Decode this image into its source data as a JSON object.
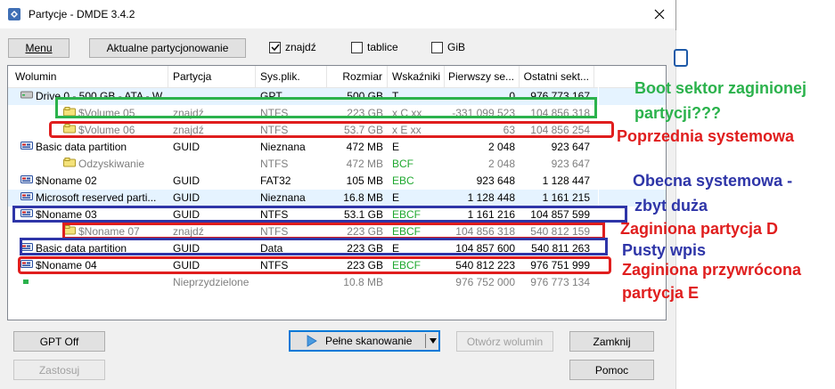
{
  "window": {
    "title": "Partycje - DMDE 3.4.2",
    "icons": {
      "app": "dmde-app-icon",
      "close": "close-icon"
    }
  },
  "toolbar": {
    "menu_label": "Menu",
    "current_partitioning_label": "Aktualne partycjonowanie",
    "checkboxes": [
      {
        "label": "znajdź",
        "checked": true
      },
      {
        "label": "tablice",
        "checked": false
      },
      {
        "label": "GiB",
        "checked": false
      }
    ]
  },
  "columns": [
    "Wolumin",
    "Partycja",
    "Sys.plik.",
    "Rozmiar",
    "Wskaźniki",
    "Pierwszy se...",
    "Ostatni sekt..."
  ],
  "rows": [
    {
      "indent": 0,
      "icon": "drive-icon",
      "name": "Drive 0 - 500 GB - ATA - W...",
      "partition": "",
      "fs": "GPT",
      "size": "500 GB",
      "flags": "T",
      "first": "0",
      "last": "976 773 167",
      "gray": false,
      "selected": true
    },
    {
      "indent": 1,
      "icon": "found-volume-icon",
      "name": "$Volume 05",
      "partition": "znajdź",
      "fs": "NTFS",
      "size": "223 GB",
      "flags": "x C xx",
      "first": "-331 099 523",
      "last": "104 856 318",
      "gray": true,
      "selected": false
    },
    {
      "indent": 1,
      "icon": "found-volume-icon",
      "name": "$Volume 06",
      "partition": "znajdź",
      "fs": "NTFS",
      "size": "53.7 GB",
      "flags": "x E xx",
      "first": "63",
      "last": "104 856 254",
      "gray": true,
      "selected": false
    },
    {
      "indent": 0,
      "icon": "partition-icon",
      "name": "Basic data partition",
      "partition": "GUID",
      "fs": "Nieznana",
      "size": "472 MB",
      "flags": "E",
      "first": "2 048",
      "last": "923 647",
      "gray": false,
      "selected": false
    },
    {
      "indent": 1,
      "icon": "found-volume-icon",
      "name": "Odzyskiwanie",
      "partition": "",
      "fs": "NTFS",
      "size": "472 MB",
      "flags": "BCF",
      "first": "2 048",
      "last": "923 647",
      "gray": true,
      "selected": false,
      "flags_green": true
    },
    {
      "indent": 0,
      "icon": "partition-icon",
      "name": "$Noname 02",
      "partition": "GUID",
      "fs": "FAT32",
      "size": "105 MB",
      "flags": "EBC",
      "first": "923 648",
      "last": "1 128 447",
      "gray": false,
      "selected": false,
      "flags_green": true
    },
    {
      "indent": 0,
      "icon": "partition-icon",
      "name": "Microsoft reserved parti...",
      "partition": "GUID",
      "fs": "Nieznana",
      "size": "16.8 MB",
      "flags": "E",
      "first": "1 128 448",
      "last": "1 161 215",
      "gray": false,
      "selected": true
    },
    {
      "indent": 0,
      "icon": "partition-icon",
      "name": "$Noname 03",
      "partition": "GUID",
      "fs": "NTFS",
      "size": "53.1 GB",
      "flags": "EBCF",
      "first": "1 161 216",
      "last": "104 857 599",
      "gray": false,
      "selected": false,
      "flags_green": true
    },
    {
      "indent": 1,
      "icon": "found-volume-icon",
      "name": "$Noname 07",
      "partition": "znajdź",
      "fs": "NTFS",
      "size": "223 GB",
      "flags": "EBCF",
      "first": "104 856 318",
      "last": "540 812 159",
      "gray": true,
      "selected": false,
      "flags_green": true
    },
    {
      "indent": 0,
      "icon": "partition-icon",
      "name": "Basic data partition",
      "partition": "GUID",
      "fs": "Data",
      "size": "223 GB",
      "flags": "E",
      "first": "104 857 600",
      "last": "540 811 263",
      "gray": false,
      "selected": false
    },
    {
      "indent": 0,
      "icon": "partition-icon",
      "name": "$Noname 04",
      "partition": "GUID",
      "fs": "NTFS",
      "size": "223 GB",
      "flags": "EBCF",
      "first": "540 812 223",
      "last": "976 751 999",
      "gray": false,
      "selected": false,
      "flags_green": true
    },
    {
      "indent": 0,
      "icon": "unallocated-icon",
      "name": "",
      "partition": "Nieprzydzielone",
      "fs": "",
      "size": "10.8 MB",
      "flags": "",
      "first": "976 752 000",
      "last": "976 773 134",
      "gray": true,
      "selected": false
    }
  ],
  "buttons": {
    "gpt_off": "GPT Off",
    "apply": "Zastosuj",
    "full_scan": "Pełne skanowanie",
    "open_volume": "Otwórz wolumin",
    "close": "Zamknij",
    "help": "Pomoc"
  },
  "annotations": {
    "boot_sector": "Boot sektor zaginionej",
    "boot_sector_2": "partycji???",
    "previous_system": "Poprzednia systemowa",
    "current_system": "Obecna systemowa -",
    "current_system_2": "zbyt duża",
    "lost_d": "Zaginiona partycja D",
    "empty_entry": "Pusty wpis",
    "lost_restored_e": "Zaginiona przywrócona",
    "lost_restored_e_2": "partycja E"
  },
  "colors": {
    "annotation_green": "#2bb24c",
    "annotation_red": "#e01e1e",
    "annotation_blue": "#2e35a8",
    "flags_green": "#1fa82f",
    "selection": "#e5f3ff"
  }
}
